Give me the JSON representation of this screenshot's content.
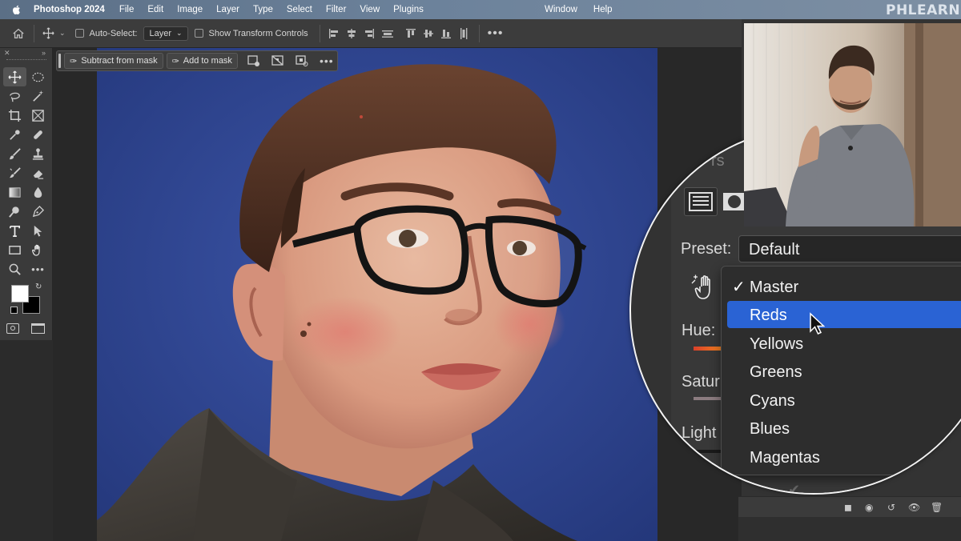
{
  "menubar": {
    "app_name": "Photoshop 2024",
    "items": [
      "File",
      "Edit",
      "Image",
      "Layer",
      "Type",
      "Select",
      "Filter",
      "View",
      "Plugins"
    ],
    "right_items": [
      "Window",
      "Help"
    ],
    "brand": "PHLEARN"
  },
  "options_bar": {
    "auto_select_label": "Auto-Select:",
    "auto_select_value": "Layer",
    "show_transform_label": "Show Transform Controls"
  },
  "mask_bar": {
    "subtract_label": "Subtract from mask",
    "add_label": "Add to mask"
  },
  "panel": {
    "partial_title": "rs",
    "preset_label": "Preset:",
    "preset_value": "Default",
    "hue_label": "Hue:",
    "saturation_label": "Satur",
    "lightness_label": "Light"
  },
  "dropdown": {
    "items": [
      "Master",
      "Reds",
      "Yellows",
      "Greens",
      "Cyans",
      "Blues",
      "Magentas"
    ],
    "checked": "Master",
    "highlighted": "Reds"
  },
  "colors": {
    "accent": "#2a63d4",
    "canvas_background": "#2d3f8a",
    "ui_dark": "#333333"
  },
  "icons": {
    "toolbar": [
      "move-icon",
      "marquee-icon",
      "lasso-icon",
      "magic-wand-icon",
      "crop-icon",
      "frame-icon",
      "eyedropper-icon",
      "healing-icon",
      "brush-icon",
      "stamp-icon",
      "history-brush-icon",
      "eraser-icon",
      "gradient-icon",
      "blur-icon",
      "dodge-icon",
      "pen-icon",
      "type-icon",
      "path-select-icon",
      "rectangle-icon",
      "hand-icon",
      "zoom-icon",
      "more-icon"
    ]
  }
}
